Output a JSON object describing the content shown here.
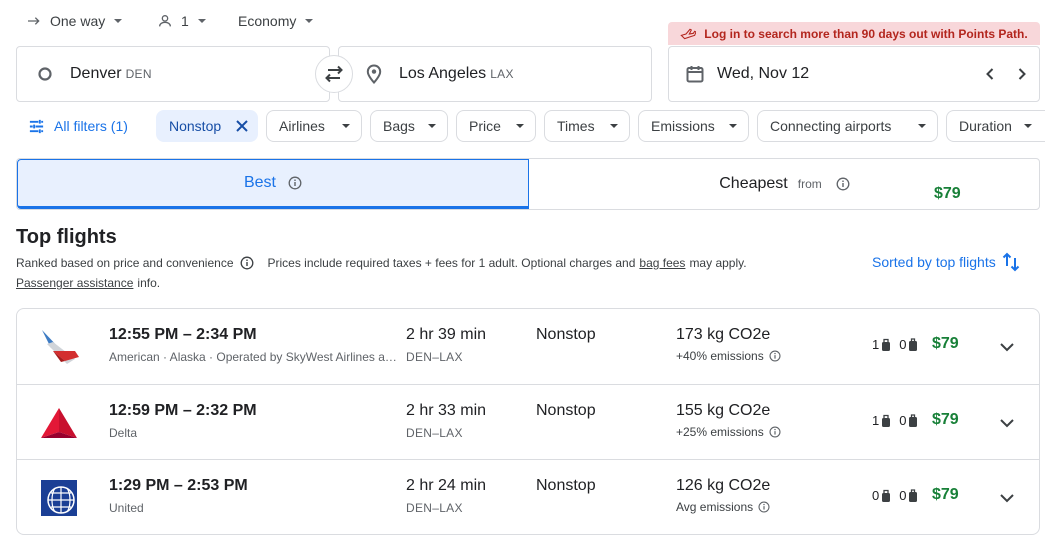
{
  "trip_options": {
    "trip_type": "One way",
    "passengers": "1",
    "cabin": "Economy"
  },
  "promo": {
    "text": "Log in to search more than 90 days out with Points Path.",
    "color": "#b3261e"
  },
  "search": {
    "origin_city": "Denver",
    "origin_code": "DEN",
    "destination_city": "Los Angeles",
    "destination_code": "LAX",
    "date": "Wed, Nov 12"
  },
  "filters": {
    "all_filters": "All filters (1)",
    "selected_chip": "Nonstop",
    "chips": [
      "Airlines",
      "Bags",
      "Price",
      "Times",
      "Emissions",
      "Connecting airports",
      "Duration"
    ]
  },
  "tabs": {
    "best": "Best",
    "cheapest": "Cheapest",
    "cheapest_from": "from",
    "cheapest_price": "$79"
  },
  "section": {
    "title": "Top flights",
    "ranked": "Ranked based on price and convenience",
    "prices_note": "Prices include required taxes + fees for 1 adult. Optional charges and",
    "bag_fees": "bag fees",
    "may_apply": "may apply.",
    "passenger_assistance": "Passenger assistance",
    "info": "info.",
    "sorted": "Sorted by top flights"
  },
  "flights": [
    {
      "times": "12:55 PM – 2:34 PM",
      "airline": "American · Alaska · Operated by SkyWest Airlines as American Eagle",
      "duration": "2 hr 39 min",
      "route": "DEN–LAX",
      "stops": "Nonstop",
      "co2": "173 kg CO2e",
      "emissions": "+40% emissions",
      "carry_on": "1",
      "checked": "0",
      "price": "$79",
      "logo_icon": "american-airlines-logo"
    },
    {
      "times": "12:59 PM – 2:32 PM",
      "airline": "Delta",
      "duration": "2 hr 33 min",
      "route": "DEN–LAX",
      "stops": "Nonstop",
      "co2": "155 kg CO2e",
      "emissions": "+25% emissions",
      "carry_on": "1",
      "checked": "0",
      "price": "$79",
      "logo_icon": "delta-logo"
    },
    {
      "times": "1:29 PM – 2:53 PM",
      "airline": "United",
      "duration": "2 hr 24 min",
      "route": "DEN–LAX",
      "stops": "Nonstop",
      "co2": "126 kg CO2e",
      "emissions": "Avg emissions",
      "carry_on": "0",
      "checked": "0",
      "price": "$79",
      "logo_icon": "united-logo"
    }
  ],
  "colors": {
    "accent": "#1a73e8",
    "price_green": "#188038",
    "selected_bg": "#e8f0fe",
    "border": "#dadce0"
  }
}
